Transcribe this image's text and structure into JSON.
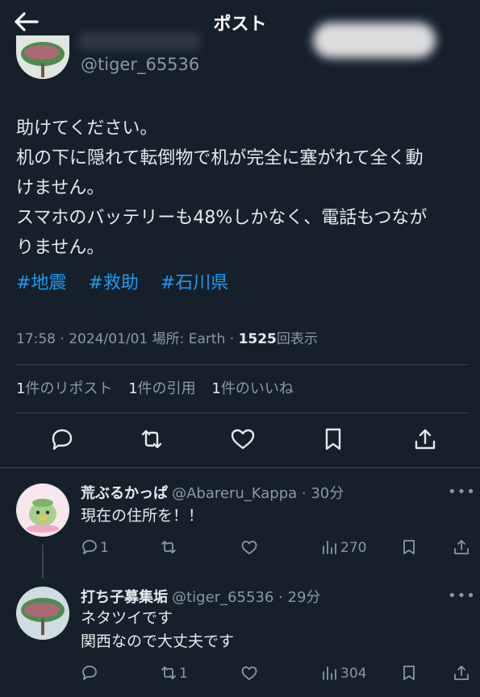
{
  "header": {
    "title": "ポスト",
    "back_icon": "arrow-left-icon"
  },
  "post": {
    "handle": "@tiger_65536",
    "lines": [
      "助けてください。",
      "机の下に隠れて転倒物で机が完全に塞がれて全く動",
      "けません。",
      "スマホのバッテリーも48%しかなく、電話もつなが",
      "りません。"
    ],
    "hashtags": [
      "#地震",
      "#救助",
      "#石川県"
    ],
    "meta": {
      "time": "17:58",
      "date": "2024/01/01",
      "location": "場所: Earth",
      "views": "1525",
      "views_label": "回表示"
    },
    "stats": [
      {
        "count": "1",
        "label": "件のリポスト"
      },
      {
        "count": "1",
        "label": "件の引用"
      },
      {
        "count": "1",
        "label": "件のいいね"
      }
    ],
    "actions": [
      "reply-icon",
      "repost-icon",
      "like-icon",
      "bookmark-icon",
      "share-icon"
    ]
  },
  "replies": [
    {
      "name": "荒ぶるかっぱ",
      "handle": "@Abareru_Kappa",
      "time": "30分",
      "text": [
        "現在の住所を！！"
      ],
      "reply_count": "1",
      "repost_count": "",
      "like_count": "",
      "views": "270"
    },
    {
      "name": "打ち子募集垢",
      "handle": "@tiger_65536",
      "time": "29分",
      "text": [
        "ネタツイです",
        "関西なので大丈夫です"
      ],
      "reply_count": "",
      "repost_count": "1",
      "like_count": "",
      "views": "304"
    }
  ],
  "more_label": "•••",
  "colors": {
    "background": "#15202b",
    "accent": "#1d9bf0",
    "muted": "#8b98a5",
    "text": "#e7e9ea"
  }
}
